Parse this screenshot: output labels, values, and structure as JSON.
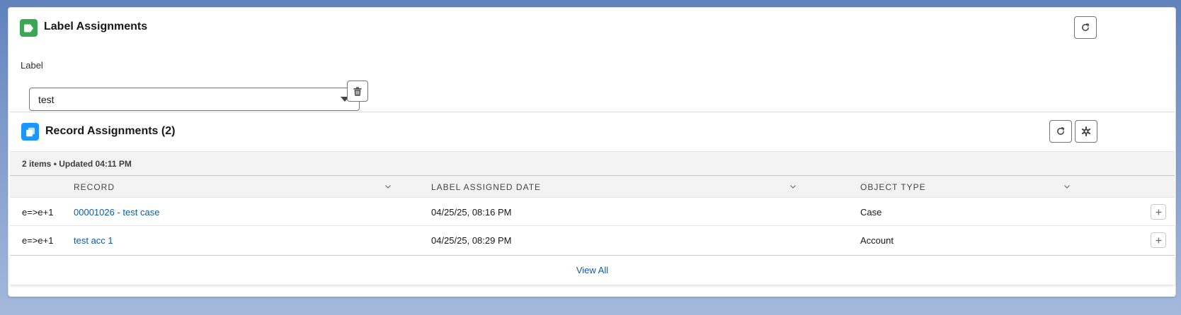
{
  "label_assignments": {
    "title": "Label Assignments",
    "icon": "label-icon",
    "refresh_icon": "refresh-icon",
    "field_label": "Label",
    "selected_label": "test",
    "delete_icon": "trash-icon"
  },
  "record_assignments": {
    "title": "Record Assignments (2)",
    "icon": "copy-records-icon",
    "refresh_icon": "refresh-icon",
    "settings_icon": "gear-icon",
    "meta": "2 items • Updated 04:11 PM",
    "columns": [
      "Record",
      "Label Assigned Date",
      "Object Type"
    ],
    "rows": [
      {
        "prefix": "e=>e+1",
        "record": "00001026 - test case",
        "date": "04/25/25, 08:16 PM",
        "object_type": "Case"
      },
      {
        "prefix": "e=>e+1",
        "record": "test acc 1",
        "date": "04/25/25, 08:29 PM",
        "object_type": "Account"
      }
    ],
    "view_all": "View All"
  },
  "colors": {
    "green_icon": "#3ba755",
    "blue_icon": "#1b96ff",
    "link": "#0b5cab"
  }
}
